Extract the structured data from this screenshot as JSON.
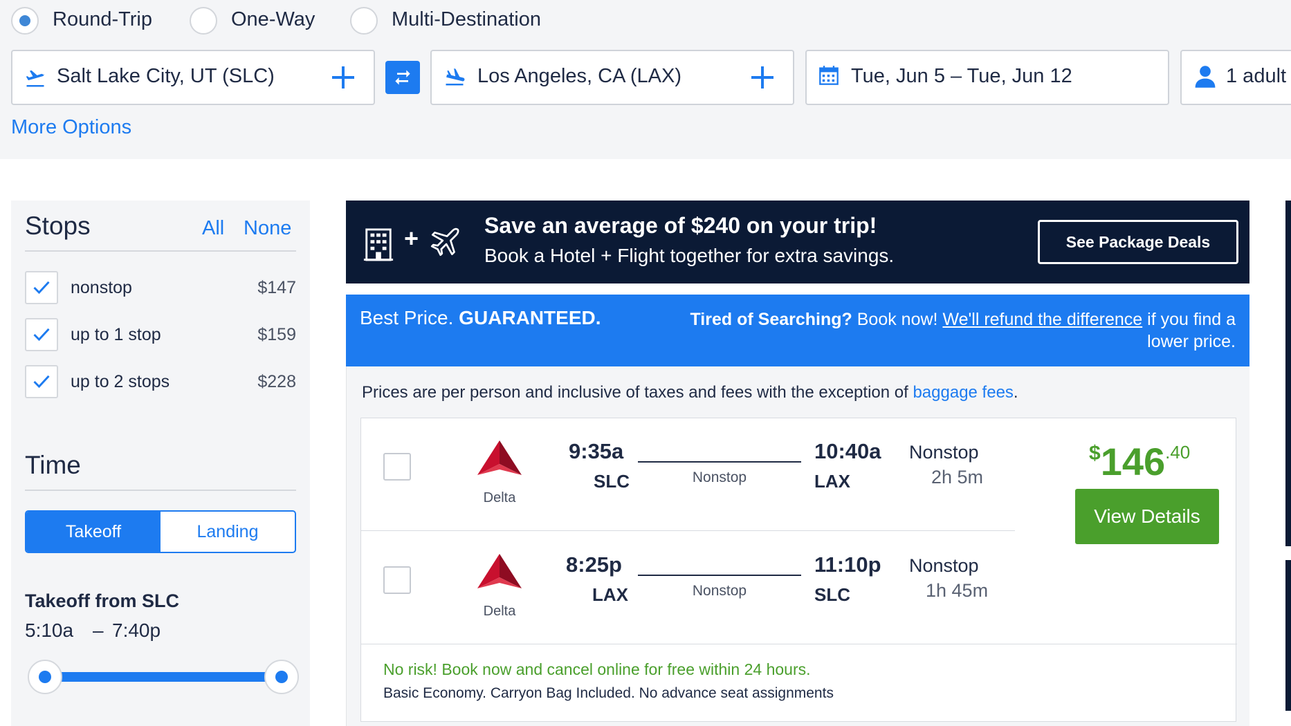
{
  "trip_type": {
    "options": [
      "Round-Trip",
      "One-Way",
      "Multi-Destination"
    ],
    "selected": "Round-Trip"
  },
  "search": {
    "origin": "Salt Lake City, UT (SLC)",
    "destination": "Los Angeles, CA (LAX)",
    "dates": "Tue, Jun 5 – Tue, Jun 12",
    "travelers": "1 adult",
    "more_options": "More Options"
  },
  "filters": {
    "stops": {
      "title": "Stops",
      "all": "All",
      "none": "None",
      "items": [
        {
          "label": "nonstop",
          "price": "$147",
          "checked": true
        },
        {
          "label": "up to 1 stop",
          "price": "$159",
          "checked": true
        },
        {
          "label": "up to 2 stops",
          "price": "$228",
          "checked": true
        }
      ]
    },
    "time": {
      "title": "Time",
      "toggle": [
        "Takeoff",
        "Landing"
      ],
      "selected": "Takeoff",
      "takeoff_title": "Takeoff from SLC",
      "range_start": "5:10a",
      "range_sep": "–",
      "range_end": "7:40p"
    }
  },
  "promo": {
    "headline": "Save an average of $240 on your trip!",
    "subline": "Book a Hotel + Flight together for extra savings.",
    "button": "See Package Deals",
    "plus": "+"
  },
  "guarantee": {
    "left_plain": "Best Price. ",
    "left_bold": "GUARANTEED.",
    "right_bold": "Tired of Searching?",
    "right_plain": " Book now! ",
    "right_link": "We'll refund the difference",
    "right_tail1": " if you find a",
    "right_tail2": "lower price."
  },
  "notice": {
    "text": "Prices are per person and inclusive of taxes and fees with the exception of ",
    "link": "baggage fees",
    "end": "."
  },
  "result": {
    "price_symbol": "$",
    "price_main": "146",
    "price_cents": ".40",
    "view_details": "View Details",
    "legs": [
      {
        "airline": "Delta",
        "depart_time": "9:35a",
        "depart_code": "SLC",
        "arrive_time": "10:40a",
        "arrive_code": "LAX",
        "line_label": "Nonstop",
        "stops": "Nonstop",
        "duration": "2h 5m"
      },
      {
        "airline": "Delta",
        "depart_time": "8:25p",
        "depart_code": "LAX",
        "arrive_time": "11:10p",
        "arrive_code": "SLC",
        "line_label": "Nonstop",
        "stops": "Nonstop",
        "duration": "1h 45m"
      }
    ],
    "no_risk": "No risk! Book now and cancel online for free within 24 hours.",
    "fare_note": "Basic Economy. Carryon Bag Included. No advance seat assignments"
  },
  "colors": {
    "accent": "#1d7bf0",
    "dark_banner": "#0b1a35",
    "price_green": "#4a9f2c",
    "delta_red": "#c8102e"
  }
}
